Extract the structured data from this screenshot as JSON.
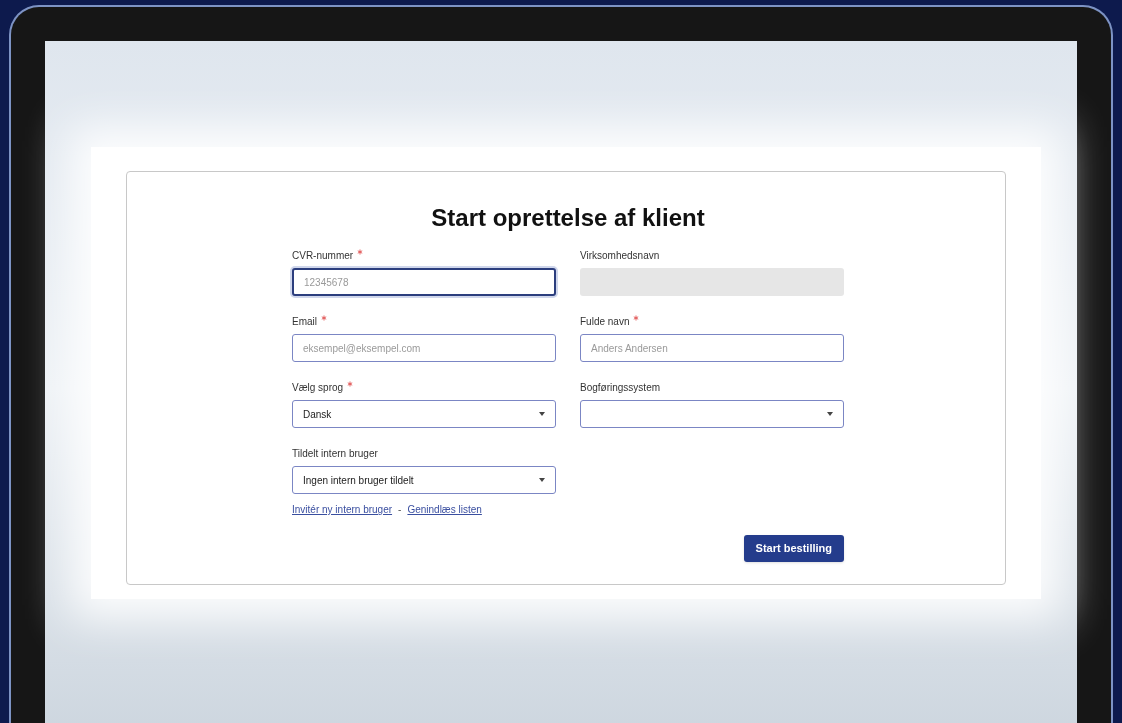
{
  "form": {
    "title": "Start oprettelse af klient",
    "fields": [
      {
        "kind": "text",
        "label": "CVR-nummer",
        "required": true,
        "placeholder": "12345678",
        "focused": true,
        "disabled": false
      },
      {
        "kind": "text",
        "label": "Virksomhedsnavn",
        "required": false,
        "focused": false,
        "disabled": true
      },
      {
        "kind": "text",
        "label": "Email",
        "required": true,
        "placeholder": "eksempel@eksempel.com",
        "focused": false,
        "disabled": false
      },
      {
        "kind": "text",
        "label": "Fulde navn",
        "required": true,
        "placeholder": "Anders Andersen",
        "focused": false,
        "disabled": false
      },
      {
        "kind": "select",
        "label": "Vælg sprog",
        "required": true,
        "value": "Dansk",
        "focused": false,
        "disabled": false
      },
      {
        "kind": "select",
        "label": "Bogføringssystem",
        "required": false,
        "focused": false,
        "disabled": false
      },
      {
        "kind": "select",
        "label": "Tildelt intern bruger",
        "required": false,
        "value": "Ingen intern bruger tildelt",
        "focused": false,
        "disabled": false
      }
    ],
    "links": [
      "Invitér ny intern bruger",
      "Genindlæs listen"
    ],
    "link_separator": "-",
    "submit_button": "Start bestilling"
  }
}
